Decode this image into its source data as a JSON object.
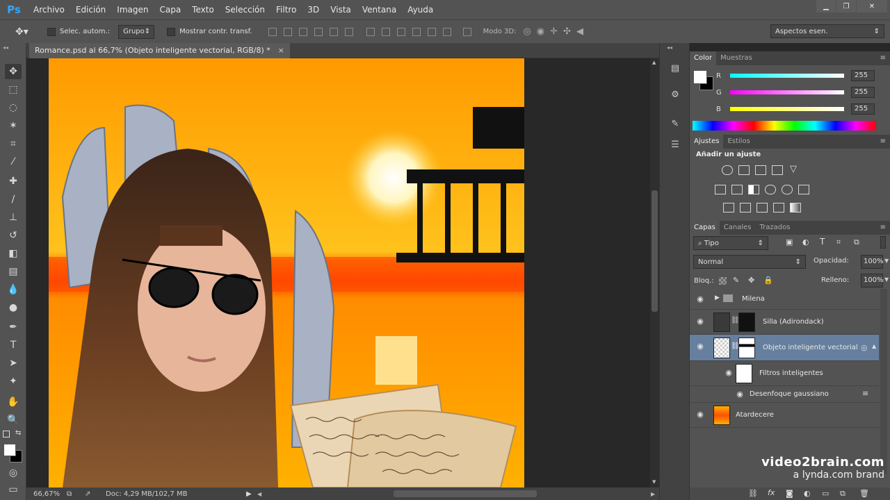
{
  "app": {
    "logo": "Ps"
  },
  "menu": [
    "Archivo",
    "Edición",
    "Imagen",
    "Capa",
    "Texto",
    "Selección",
    "Filtro",
    "3D",
    "Vista",
    "Ventana",
    "Ayuda"
  ],
  "window_controls": {
    "minimize": "▁",
    "maximize": "❐",
    "close": "✕"
  },
  "options": {
    "auto_select_label": "Selec. autom.:",
    "auto_select_value": "Grupo",
    "show_transform_label": "Mostrar contr. transf.",
    "mode3d_label": "Modo 3D:",
    "workspace": "Aspectos esen."
  },
  "document": {
    "tab_title": "Romance.psd al 66,7% (Objeto inteligente vectorial, RGB/8) *",
    "tab_close": "×",
    "zoom": "66,67%",
    "doc_info": "Doc: 4,29 MB/102,7 MB"
  },
  "color_panel": {
    "tabs": [
      "Color",
      "Muestras"
    ],
    "r_label": "R",
    "g_label": "G",
    "b_label": "B",
    "r": "255",
    "g": "255",
    "b": "255"
  },
  "adjustments_panel": {
    "tabs": [
      "Ajustes",
      "Estilos"
    ],
    "heading": "Añadir un ajuste"
  },
  "layers_panel": {
    "tabs": [
      "Capas",
      "Canales",
      "Trazados"
    ],
    "filter_kind": "Tipo",
    "blend_mode": "Normal",
    "opacity_label": "Opacidad:",
    "opacity": "100%",
    "lock_label": "Bloq.:",
    "fill_label": "Relleno:",
    "fill": "100%",
    "layers": [
      {
        "name": "Milena"
      },
      {
        "name": "Silla (Adirondack)"
      },
      {
        "name": "Objeto inteligente vectorial"
      },
      {
        "name": "Filtros inteligentes"
      },
      {
        "name": "Desenfoque gaussiano"
      },
      {
        "name": "Atardecere"
      }
    ]
  },
  "watermark": {
    "line1": "video2brain.com",
    "line2": "a lynda.com brand"
  }
}
